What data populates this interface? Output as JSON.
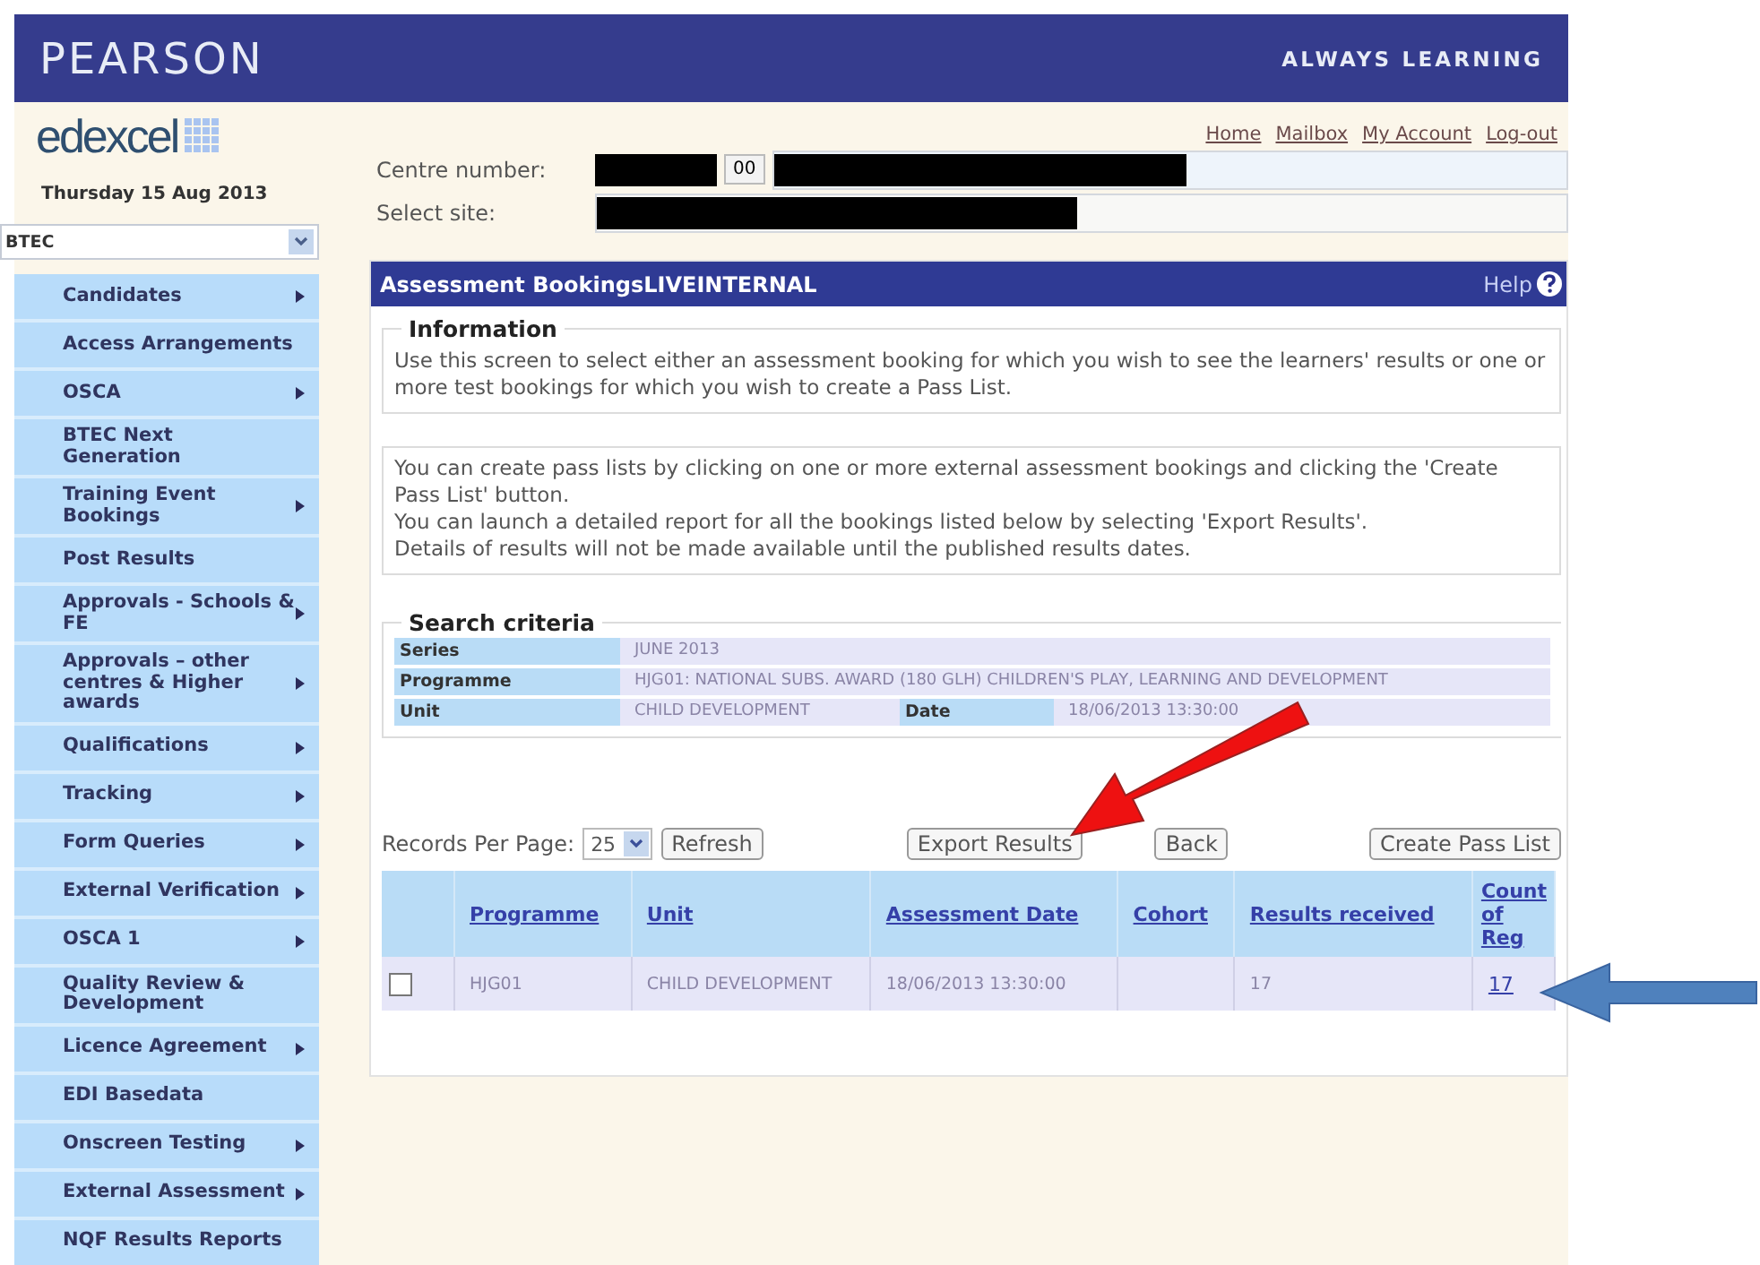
{
  "header": {
    "brand": "PEARSON",
    "tagline": "ALWAYS LEARNING"
  },
  "logo": "edexcel",
  "date": "Thursday 15 Aug 2013",
  "qualification_select": {
    "value": "BTEC"
  },
  "sidebar": {
    "items": [
      {
        "label": "Candidates",
        "submenu": true
      },
      {
        "label": "Access Arrangements",
        "submenu": false
      },
      {
        "label": "OSCA",
        "submenu": true
      },
      {
        "label": "BTEC Next Generation",
        "submenu": false
      },
      {
        "label": "Training Event Bookings",
        "submenu": true
      },
      {
        "label": "Post Results",
        "submenu": false
      },
      {
        "label": "Approvals - Schools & FE",
        "submenu": true
      },
      {
        "label": "Approvals – other centres & Higher awards",
        "submenu": true
      },
      {
        "label": "Qualifications",
        "submenu": true
      },
      {
        "label": "Tracking",
        "submenu": true
      },
      {
        "label": "Form Queries",
        "submenu": true
      },
      {
        "label": "External Verification",
        "submenu": true
      },
      {
        "label": "OSCA 1",
        "submenu": true
      },
      {
        "label": "Quality Review & Development",
        "submenu": false
      },
      {
        "label": "Licence Agreement",
        "submenu": true
      },
      {
        "label": "EDI Basedata",
        "submenu": false
      },
      {
        "label": "Onscreen Testing",
        "submenu": true
      },
      {
        "label": "External Assessment",
        "submenu": true
      },
      {
        "label": "NQF Results Reports",
        "submenu": false
      }
    ]
  },
  "top_links": [
    "Home",
    "Mailbox",
    "My Account",
    "Log-out"
  ],
  "centre": {
    "label": "Centre number:",
    "code": "00",
    "site_label": "Select site:"
  },
  "panel": {
    "title": "Assessment BookingsLIVEINTERNAL",
    "help": "Help"
  },
  "information": {
    "legend": "Information",
    "text": "Use this screen to select either an assessment booking for which you wish to see the learners' results or one or more test bookings for which you wish to create a Pass List."
  },
  "notes": [
    "You can create pass lists by clicking on one or more external assessment bookings and clicking the 'Create Pass List' button.",
    "You can launch a detailed report for all the bookings listed below by selecting 'Export Results'.",
    "Details of results will not be made available until the published results dates."
  ],
  "search_criteria": {
    "legend": "Search criteria",
    "series_label": "Series",
    "series": "JUNE 2013",
    "programme_label": "Programme",
    "programme": "HJG01: NATIONAL SUBS. AWARD (180 GLH) CHILDREN'S PLAY, LEARNING AND DEVELOPMENT",
    "unit_label": "Unit",
    "unit": "CHILD DEVELOPMENT",
    "date_label": "Date",
    "date": "18/06/2013 13:30:00"
  },
  "records_per_page": {
    "label": "Records Per Page:",
    "value": "25"
  },
  "buttons": [
    "Refresh",
    "Export Results",
    "Back",
    "Create Pass List"
  ],
  "table": {
    "columns": [
      "Programme",
      "Unit",
      "Assessment Date",
      "Cohort",
      "Results received",
      "Count of Reg"
    ],
    "rows": [
      {
        "checked": false,
        "cells": [
          "HJG01",
          "CHILD DEVELOPMENT",
          "18/06/2013 13:30:00",
          "",
          "17",
          "17"
        ]
      }
    ]
  },
  "annotations": [
    {
      "kind": "red-arrow"
    },
    {
      "kind": "blue-arrow"
    }
  ]
}
